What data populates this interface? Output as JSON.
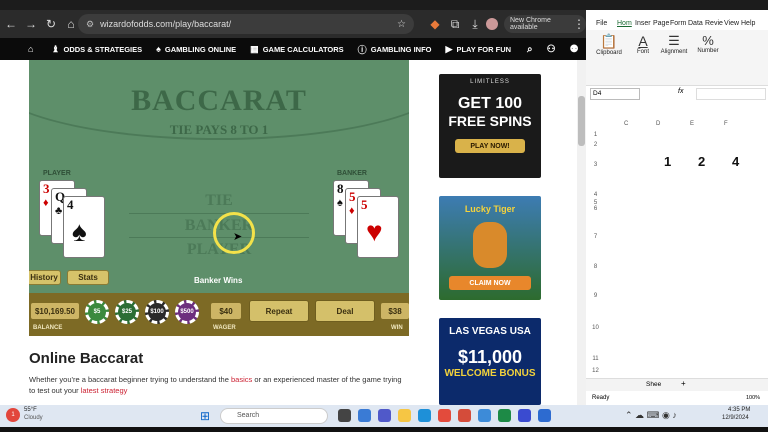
{
  "browser": {
    "url": "wizardofodds.com/play/baccarat/",
    "new_chrome_label": "New Chrome available"
  },
  "site_nav": {
    "items": [
      {
        "label": "ODDS & STRATEGIES"
      },
      {
        "label": "GAMBLING ONLINE"
      },
      {
        "label": "GAME CALCULATORS"
      },
      {
        "label": "GAMBLING INFO"
      },
      {
        "label": "PLAY FOR FUN"
      }
    ]
  },
  "game": {
    "title": "BACCARAT",
    "subtitle": "TIE PAYS 8 TO 1",
    "player_label": "PLAYER",
    "banker_label": "BANKER",
    "felt_tie": "TIE",
    "felt_banker": "BANKER",
    "felt_player": "PLAYER",
    "result_text": "Banker Wins",
    "history_btn": "History",
    "stats_btn": "Stats",
    "player_cards": [
      {
        "rank": "3",
        "suit": "♦"
      },
      {
        "rank": "Q",
        "suit": "♣"
      },
      {
        "rank": "4",
        "suit": "♠"
      }
    ],
    "banker_cards": [
      {
        "rank": "8",
        "suit": "♠"
      },
      {
        "rank": "5",
        "suit": "♦"
      },
      {
        "rank": "5",
        "suit": "♥"
      }
    ],
    "balance_value": "$10,169.50",
    "balance_label": "BALANCE",
    "chips": [
      "$5",
      "$25",
      "$100",
      "$500"
    ],
    "wager_value": "$40",
    "wager_label": "WAGER",
    "repeat_btn": "Repeat",
    "deal_btn": "Deal",
    "win_value": "$38",
    "win_label": "WIN"
  },
  "article": {
    "heading": "Online Baccarat",
    "text_before": "Whether you're a baccarat beginner trying to understand the ",
    "link1": "basics",
    "text_middle": " or an experienced master of the game trying to test out your ",
    "link2": "latest strategy"
  },
  "ads": [
    {
      "brand": "LIMITLESS",
      "line1": "GET 100",
      "line2": "FREE SPINS",
      "cta": "PLAY NOW!"
    },
    {
      "brand": "Lucky Tiger",
      "cta": "CLAIM NOW"
    },
    {
      "brand": "LAS VEGAS USA",
      "line1": "$11,000",
      "line2": "WELCOME BONUS"
    }
  ],
  "excel": {
    "tabs": [
      "File",
      "Hom",
      "Inser",
      "Page",
      "Form",
      "Data",
      "Revie",
      "View",
      "Help"
    ],
    "groups": [
      "Clipboard",
      "Font",
      "Alignment",
      "Number"
    ],
    "name_box": "D4",
    "fx": "fx",
    "columns": [
      "C",
      "D",
      "E",
      "F"
    ],
    "rows": [
      "1",
      "2",
      "3",
      "4",
      "5",
      "6",
      "7",
      "8",
      "9",
      "10",
      "11",
      "12"
    ],
    "cells": [
      {
        "value": "1"
      },
      {
        "value": "2"
      },
      {
        "value": "4"
      }
    ],
    "sheet_tab": "Shee",
    "status": "Ready",
    "zoom": "100%"
  },
  "taskbar": {
    "weather_temp": "55°F",
    "weather_desc": "Cloudy",
    "search_placeholder": "Search",
    "time": "4:35 PM",
    "date": "12/9/2024"
  }
}
